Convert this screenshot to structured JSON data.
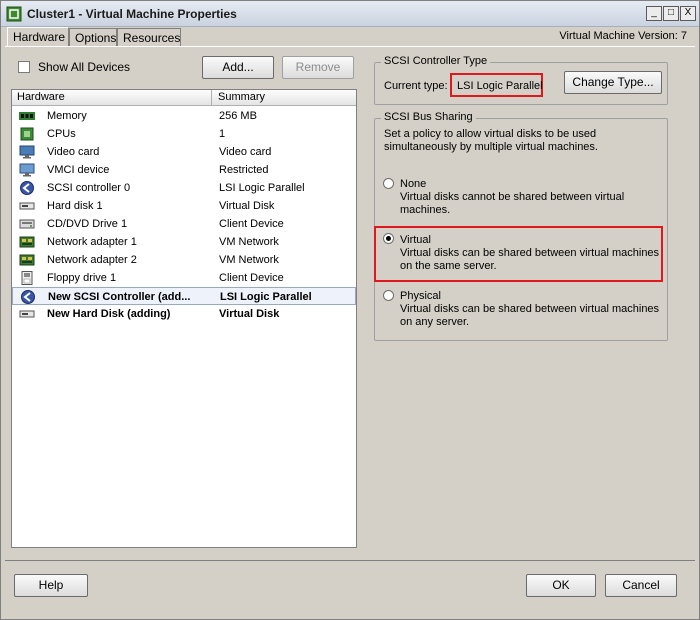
{
  "window": {
    "title": "Cluster1 - Virtual Machine Properties",
    "minimize_glyph": "_",
    "maximize_glyph": "□",
    "close_glyph": "X"
  },
  "tabs": [
    {
      "label": "Hardware",
      "active": true
    },
    {
      "label": "Options",
      "active": false
    },
    {
      "label": "Resources",
      "active": false
    }
  ],
  "version_label": "Virtual Machine Version: 7",
  "hardware": {
    "show_all_devices_label": "Show All Devices",
    "show_all_devices_checked": false,
    "add_label": "Add...",
    "remove_label": "Remove",
    "columns": [
      "Hardware",
      "Summary"
    ],
    "rows": [
      {
        "name": "Memory",
        "summary": "256 MB",
        "icon": "memory-icon"
      },
      {
        "name": "CPUs",
        "summary": "1",
        "icon": "cpu-icon"
      },
      {
        "name": "Video card",
        "summary": "Video card",
        "icon": "video-card-icon"
      },
      {
        "name": "VMCI device",
        "summary": "Restricted",
        "icon": "vmci-device-icon"
      },
      {
        "name": "SCSI controller 0",
        "summary": "LSI Logic Parallel",
        "icon": "scsi-controller-icon"
      },
      {
        "name": "Hard disk 1",
        "summary": "Virtual Disk",
        "icon": "hard-disk-icon"
      },
      {
        "name": "CD/DVD Drive 1",
        "summary": "Client Device",
        "icon": "cd-dvd-icon"
      },
      {
        "name": "Network adapter 1",
        "summary": "VM Network",
        "icon": "network-adapter-icon"
      },
      {
        "name": "Network adapter 2",
        "summary": "VM Network",
        "icon": "network-adapter-icon"
      },
      {
        "name": "Floppy drive 1",
        "summary": "Client Device",
        "icon": "floppy-drive-icon"
      },
      {
        "name": "New SCSI Controller (add...",
        "summary": "LSI Logic Parallel",
        "icon": "scsi-controller-icon",
        "bold": true,
        "selected": true
      },
      {
        "name": "New Hard Disk (adding)",
        "summary": "Virtual Disk",
        "icon": "hard-disk-icon",
        "bold": true
      }
    ]
  },
  "scsi_controller_type": {
    "title": "SCSI Controller Type",
    "current_type_label": "Current type:",
    "current_type_value": "LSI Logic Parallel",
    "change_type_label": "Change Type..."
  },
  "scsi_bus_sharing": {
    "title": "SCSI Bus Sharing",
    "description": [
      "Set a policy to allow virtual disks to be used",
      "simultaneously by multiple virtual machines."
    ],
    "options": [
      {
        "label": "None",
        "desc": [
          "Virtual disks cannot be shared between virtual",
          "machines."
        ],
        "selected": false
      },
      {
        "label": "Virtual",
        "desc": [
          "Virtual disks can be shared between virtual machines",
          "on the same server."
        ],
        "selected": true
      },
      {
        "label": "Physical",
        "desc": [
          "Virtual disks can be shared between virtual machines",
          "on any server."
        ],
        "selected": false
      }
    ]
  },
  "footer": {
    "help_label": "Help",
    "ok_label": "OK",
    "cancel_label": "Cancel"
  },
  "colors": {
    "highlight_box": "#e0191f",
    "selected_row": "#eef2fa"
  }
}
